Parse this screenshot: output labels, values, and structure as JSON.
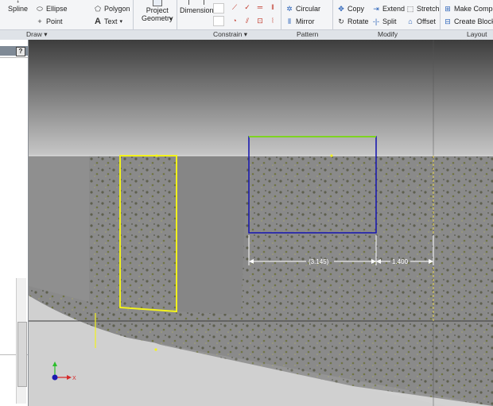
{
  "ribbon": {
    "draw": {
      "spline": "Spline",
      "ellipse": "Ellipse",
      "point": "Point",
      "polygon": "Polygon",
      "text": "Text"
    },
    "project_geometry": [
      "Project",
      "Geometry"
    ],
    "dimension": "Dimension",
    "pattern": {
      "circular": "Circular",
      "mirror": "Mirror"
    },
    "modify": {
      "copy": "Copy",
      "rotate": "Rotate",
      "extend": "Extend",
      "split": "Split",
      "stretch": "Stretch",
      "offset": "Offset"
    },
    "layout": {
      "make_components": "Make Compo",
      "create_block": "Create Block"
    },
    "groups": {
      "draw": "Draw",
      "constrain": "Constrain",
      "pattern": "Pattern",
      "modify": "Modify",
      "layout": "Layout"
    }
  },
  "browser": {
    "help_glyph": "?"
  },
  "canvas": {
    "dimension_driven": "(3.145)",
    "dimension_value": "1.400",
    "triad_x_label": "X"
  },
  "colors": {
    "sketch_yellow": "#f2f21c",
    "selected_blue": "#1b1bb0",
    "highlight_green": "#7ed321",
    "surface_gray": "#8c8c8c"
  }
}
